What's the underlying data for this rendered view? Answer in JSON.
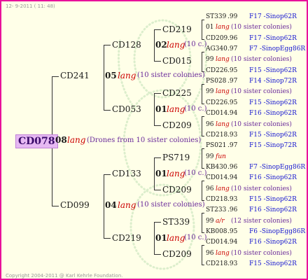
{
  "header": {
    "date": "12-  9-2011 ( 11: 48)"
  },
  "footer": {
    "copyright": "Copyright 2004-2011 @ Karl Kehrle Foundation."
  },
  "root": {
    "id": "CD078",
    "year": "08",
    "breed": "lang",
    "note": "(Drones from 10 sister colonies)"
  },
  "gen1": {
    "top": {
      "id": "CD241",
      "year": "05",
      "breed": "lang",
      "note": "(10 sister colonies)"
    },
    "bottom": {
      "id": "CD099",
      "year": "04",
      "breed": "lang",
      "note": "(10 sister colonies)"
    }
  },
  "gen2": {
    "a": {
      "id": "CD128",
      "year": "02",
      "breed": "lang",
      "note": "(10 c.)"
    },
    "b": {
      "id": "CD053",
      "year": "01",
      "breed": "lang",
      "note": "(10 c.)"
    },
    "c": {
      "id": "CD133",
      "year": "01",
      "breed": "lang",
      "note": "(10 c.)"
    },
    "d": {
      "id": "CD219",
      "year": "01",
      "breed": "lang",
      "note": "(10 c.)"
    }
  },
  "gen3": {
    "a": {
      "top": "CD219",
      "bottom": "CD015"
    },
    "b": {
      "top": "CD225",
      "bottom": "CD209"
    },
    "c": {
      "top": "PS719",
      "bottom": "CD209"
    },
    "d": {
      "top": "ST339",
      "bottom": "CD209"
    }
  },
  "gen4": [
    {
      "id": "ST339",
      "year": ".99",
      "ped": "F17 -Sinop62R"
    },
    {
      "year": "01",
      "breed": "lang",
      "note": "(10 sister colonies)"
    },
    {
      "id": "CD209",
      "year": ".96",
      "ped": "F17 -Sinop62R"
    },
    {
      "id": "AG340",
      "year": ".97",
      "ped": "F7 -SinopEgg86R"
    },
    {
      "year": "99",
      "breed": "lang",
      "note": "(10 sister colonies)"
    },
    {
      "id": "CD226",
      "year": ".95",
      "ped": "F15 -Sinop62R"
    },
    {
      "id": "PS028",
      "year": ".97",
      "ped": "F14 -Sinop72R"
    },
    {
      "year": "99",
      "breed": "lang",
      "note": "(10 sister colonies)"
    },
    {
      "id": "CD226",
      "year": ".95",
      "ped": "F15 -Sinop62R"
    },
    {
      "id": "CD014",
      "year": ".94",
      "ped": "F16 -Sinop62R"
    },
    {
      "year": "96",
      "breed": "lang",
      "note": "(10 sister colonies)"
    },
    {
      "id": "CD218",
      "year": ".93",
      "ped": "F15 -Sinop62R"
    },
    {
      "id": "PS021",
      "year": ".97",
      "ped": "F15 -Sinop72R"
    },
    {
      "year": "99",
      "breed": "fun",
      "note": ""
    },
    {
      "id": "KB430",
      "year": ".96",
      "ped": "F7 -SinopEgg86R"
    },
    {
      "id": "CD014",
      "year": ".94",
      "ped": "F16 -Sinop62R"
    },
    {
      "year": "96",
      "breed": "lang",
      "note": "(10 sister colonies)"
    },
    {
      "id": "CD218",
      "year": ".93",
      "ped": "F15 -Sinop62R"
    },
    {
      "id": "ST233",
      "year": ".96",
      "ped": "F16 -Sinop62R"
    },
    {
      "year": "99",
      "breed": "a/r",
      "note": "(12 sister colonies)"
    },
    {
      "id": "KB008",
      "year": ".95",
      "ped": "F6 -SinopEgg86R"
    },
    {
      "id": "CD014",
      "year": ".94",
      "ped": "F16 -Sinop62R"
    },
    {
      "year": "96",
      "breed": "lang",
      "note": "(10 sister colonies)"
    },
    {
      "id": "CD218",
      "year": ".93",
      "ped": "F15 -Sinop62R"
    }
  ],
  "colors": {
    "border": "#e8119a",
    "background": "#ffffe8",
    "root_highlight": "#e6b8f2",
    "pedigree_link": "#1515d0",
    "breed": "#cc0000",
    "note": "#6a2a9a"
  }
}
